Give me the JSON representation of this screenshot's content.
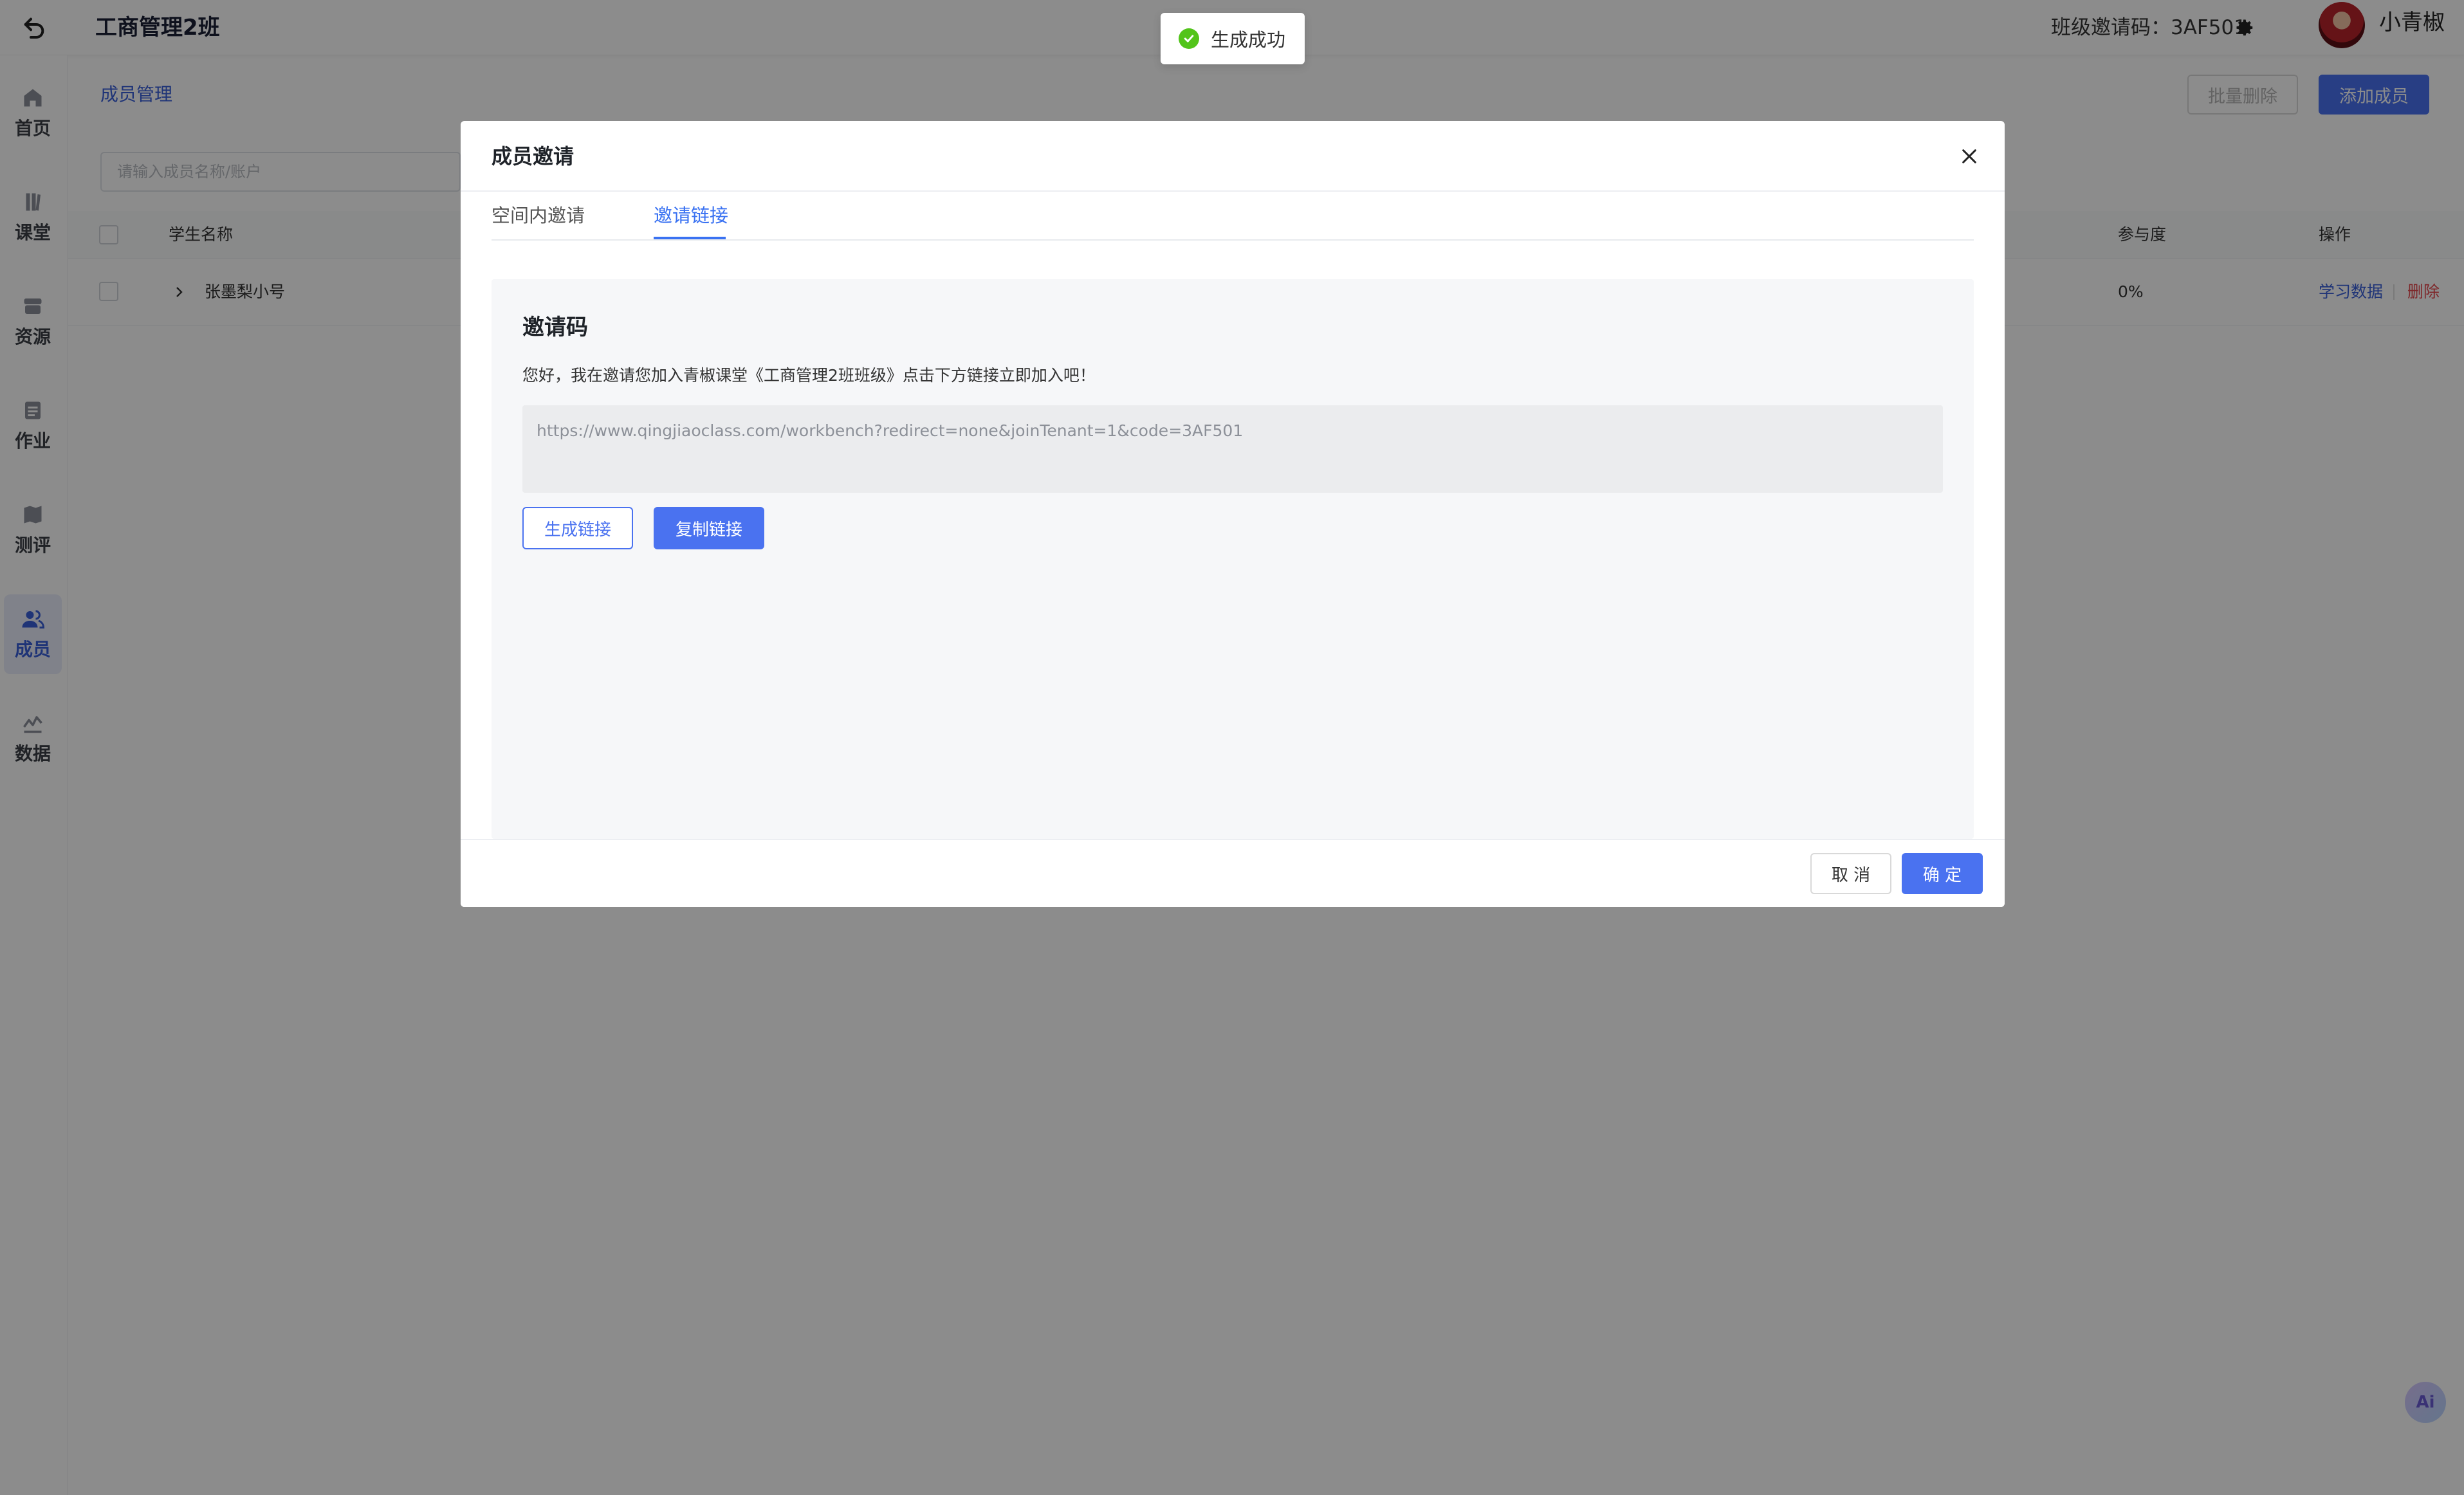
{
  "header": {
    "title": "工商管理2班",
    "invite_code_text": "班级邀请码：3AF501",
    "user_name": "小青椒"
  },
  "sidebar": {
    "items": [
      {
        "label": "首页",
        "icon": "home-icon"
      },
      {
        "label": "课堂",
        "icon": "book-icon"
      },
      {
        "label": "资源",
        "icon": "archive-icon"
      },
      {
        "label": "作业",
        "icon": "clipboard-icon"
      },
      {
        "label": "测评",
        "icon": "map-icon"
      },
      {
        "label": "成员",
        "icon": "users-icon",
        "active": true
      },
      {
        "label": "数据",
        "icon": "chart-icon"
      }
    ]
  },
  "main": {
    "breadcrumb": "成员管理",
    "batch_delete_label": "批量删除",
    "add_member_label": "添加成员",
    "search_placeholder": "请输入成员名称/账户",
    "table": {
      "columns": [
        "学生名称",
        "参与度",
        "操作"
      ],
      "rows": [
        {
          "name": "张墨梨小号",
          "participation": "0%",
          "action_data": "学习数据",
          "action_delete": "删除"
        }
      ]
    }
  },
  "toast": {
    "text": "生成成功",
    "status_color": "#52c41a"
  },
  "modal": {
    "title": "成员邀请",
    "tabs": [
      {
        "label": "空间内邀请"
      },
      {
        "label": "邀请链接",
        "active": true
      }
    ],
    "section_title": "邀请码",
    "description": "您好，我在邀请您加入青椒课堂《工商管理2班班级》点击下方链接立即加入吧！",
    "invite_link": "https://www.qingjiaoclass.com/workbench?redirect=none&joinTenant=1&code=3AF501",
    "generate_label": "生成链接",
    "copy_label": "复制链接",
    "cancel_label": "取 消",
    "ok_label": "确 定"
  },
  "ai_badge": "Ai",
  "colors": {
    "accent": "#4a72f0",
    "danger": "#e5484d",
    "success": "#52c41a"
  }
}
